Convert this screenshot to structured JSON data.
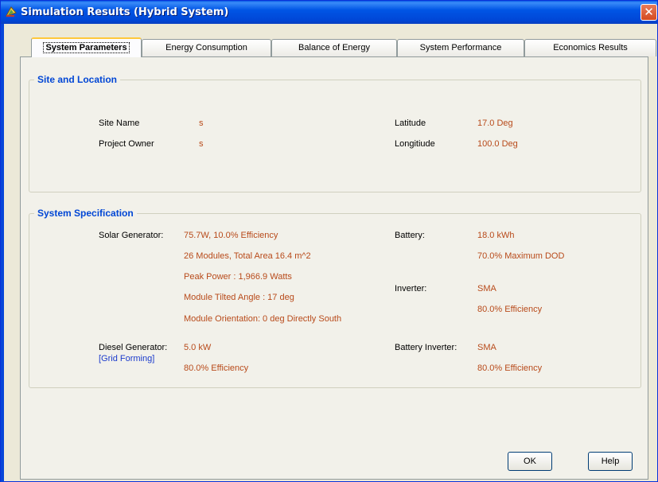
{
  "window": {
    "title": "Simulation Results (Hybrid System)"
  },
  "tabs": [
    {
      "label": "System Parameters"
    },
    {
      "label": "Energy Consumption"
    },
    {
      "label": "Balance of Energy"
    },
    {
      "label": "System Performance"
    },
    {
      "label": "Economics Results"
    }
  ],
  "site": {
    "title": "Site and Location",
    "site_name_label": "Site Name",
    "site_name_value": "s",
    "owner_label": "Project Owner",
    "owner_value": "s",
    "latitude_label": "Latitude",
    "latitude_value": "17.0  Deg",
    "longitude_label": "Longitiude",
    "longitude_value": "100.0  Deg"
  },
  "spec": {
    "title": "System Specification",
    "solar_label": "Solar Generator:",
    "solar_lines": [
      "75.7W, 10.0% Efficiency",
      "26 Modules, Total Area 16.4 m^2",
      "Peak Power :  1,966.9 Watts",
      "Module Tilted  Angle : 17 deg",
      "Module Orientation: 0 deg Directly South"
    ],
    "diesel_label": "Diesel Generator:",
    "diesel_note": "[Grid Forming]",
    "diesel_lines": [
      "5.0 kW",
      "80.0% Efficiency"
    ],
    "battery_label": "Battery:",
    "battery_lines": [
      "18.0 kWh",
      "70.0% Maximum DOD"
    ],
    "inverter_label": "Inverter:",
    "inverter_lines": [
      "SMA",
      "80.0% Efficiency"
    ],
    "battery_inverter_label": "Battery Inverter:",
    "battery_inverter_lines": [
      "SMA",
      "80.0% Efficiency"
    ]
  },
  "buttons": {
    "ok": "OK",
    "help": "Help"
  },
  "colors": {
    "title_bar": "#0055e5",
    "group_title": "#0046d5",
    "value_text": "#b84a1a",
    "note_text": "#1a3acc"
  },
  "icons": {
    "app": "app-window-icon",
    "close": "close-icon"
  }
}
